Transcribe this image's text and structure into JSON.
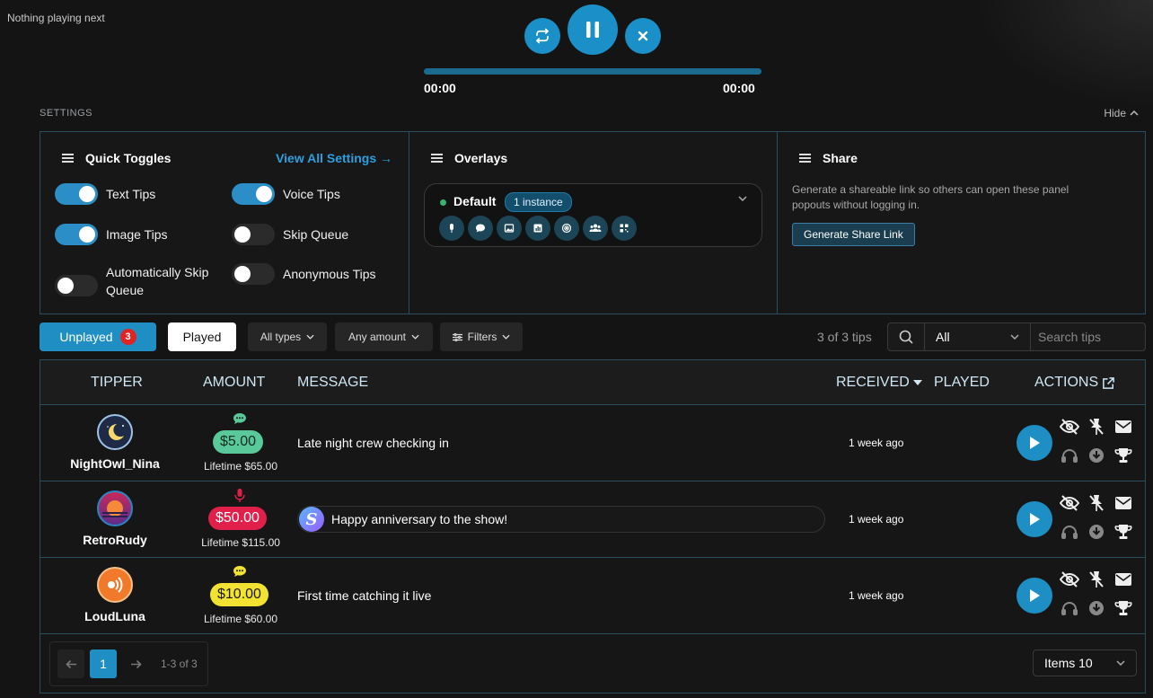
{
  "player": {
    "now_playing": "Nothing playing next",
    "time_current": "00:00",
    "time_total": "00:00",
    "progress": 0,
    "icons": [
      "repeat-icon",
      "pause-icon",
      "close-icon"
    ]
  },
  "settings": {
    "label": "SETTINGS",
    "hide_label": "Hide",
    "quick_toggles": {
      "title": "Quick Toggles",
      "view_all": "View All Settings →",
      "toggles": [
        {
          "label": "Text Tips",
          "on": true
        },
        {
          "label": "Voice Tips",
          "on": true
        },
        {
          "label": "Image Tips",
          "on": true
        },
        {
          "label": "Skip Queue",
          "on": false
        },
        {
          "label": "Automatically Skip Queue",
          "on": false
        },
        {
          "label": "Anonymous Tips",
          "on": false
        }
      ]
    },
    "overlays": {
      "title": "Overlays",
      "item_name": "Default",
      "instance_badge": "1 instance",
      "status_color": "#3cb371",
      "icons": [
        "microphone-icon",
        "chat-icon",
        "image-icon",
        "chart-icon",
        "target-icon",
        "group-icon",
        "qr-icon"
      ]
    },
    "share": {
      "title": "Share",
      "description": "Generate a shareable link so others can open these panel popouts without logging in.",
      "button": "Generate Share Link"
    }
  },
  "filters": {
    "unplayed_label": "Unplayed",
    "unplayed_count": "3",
    "played_label": "Played",
    "types": "All types",
    "amount": "Any amount",
    "filters": "Filters",
    "count_text": "3 of 3 tips",
    "search_scope": "All",
    "search_placeholder": "Search tips"
  },
  "table": {
    "headers": {
      "tipper": "TIPPER",
      "amount": "AMOUNT",
      "message": "MESSAGE",
      "received": "RECEIVED",
      "played": "PLAYED",
      "actions": "ACTIONS"
    },
    "rows": [
      {
        "tipper": "NightOwl_Nina",
        "amount": "$5.00",
        "lifetime": "Lifetime $65.00",
        "message": "Late night crew checking in",
        "received": "1 week ago",
        "type": "text",
        "amount_color": "#59c99a"
      },
      {
        "tipper": "RetroRudy",
        "amount": "$50.00",
        "lifetime": "Lifetime $115.00",
        "message": "Happy anniversary to the show!",
        "received": "1 week ago",
        "type": "voice",
        "amount_color": "#e0204a"
      },
      {
        "tipper": "LoudLuna",
        "amount": "$10.00",
        "lifetime": "Lifetime $60.00",
        "message": "First time catching it live",
        "received": "1 week ago",
        "type": "text",
        "amount_color": "#f2e232"
      }
    ]
  },
  "pagination": {
    "current_page": "1",
    "range": "1-3 of 3",
    "items_per_page": "Items 10"
  },
  "colors": {
    "accent": "#1f8ec3",
    "border": "#2a4e5e",
    "badge_red": "#e02424"
  }
}
